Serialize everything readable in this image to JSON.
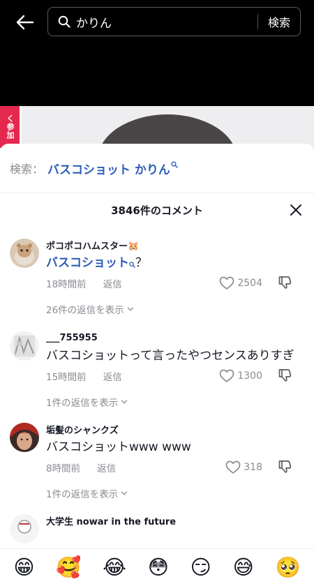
{
  "search": {
    "query": "かりん",
    "submit_label": "検索"
  },
  "video": {
    "banner_text": "く参加"
  },
  "related_search": {
    "prefix": "検索：",
    "term": "バスコショット かりん"
  },
  "comments_header": {
    "count_label": "3846件のコメント"
  },
  "comments": [
    {
      "username": "ポコポコハムスター🐹",
      "link_text": "バスコショット",
      "text_after": "？",
      "time": "18時間前",
      "reply_label": "返信",
      "likes": "2504",
      "replies_label": "26件の返信を表示"
    },
    {
      "username": "___755955",
      "text": "バスコショットって言ったやつセンスありすぎ",
      "time": "15時間前",
      "reply_label": "返信",
      "likes": "1300",
      "replies_label": "1件の返信を表示"
    },
    {
      "username": "垢髪のシャンクズ",
      "text": "バスコショットwww www",
      "time": "8時間前",
      "reply_label": "返信",
      "likes": "318",
      "replies_label": "1件の返信を表示"
    },
    {
      "username": "大学生 nowar in the future"
    }
  ],
  "emoji_bar": [
    "😁",
    "🥰",
    "😂",
    "😳",
    "😏",
    "😅",
    "🥺"
  ],
  "colors": {
    "link_blue": "#2b5db9",
    "muted_gray": "#8a8b91",
    "text_dark": "#161823",
    "banner_red": "#e5284d"
  }
}
